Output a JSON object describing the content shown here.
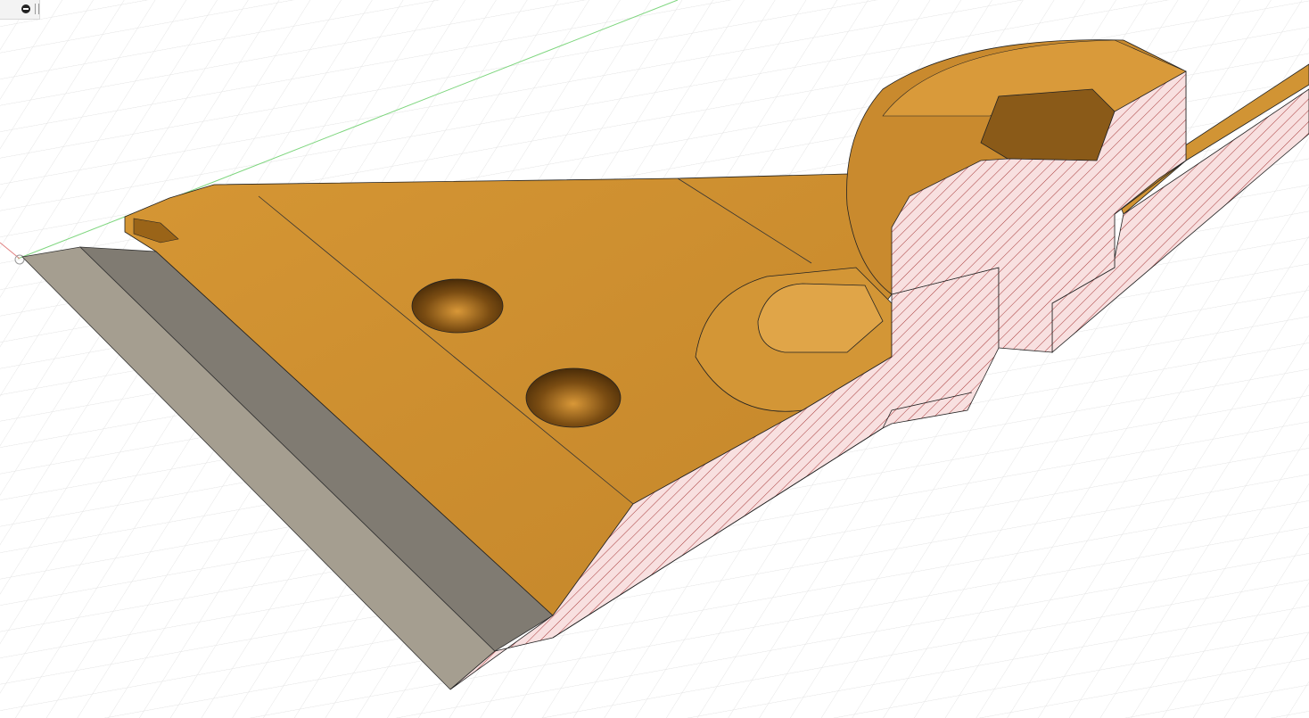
{
  "viewport": {
    "model": "section-view-scraper-body",
    "colors": {
      "body": "#c88a2c",
      "body_light": "#d99a3a",
      "body_dark": "#8a5a18",
      "blade_light": "#a59e90",
      "blade_dark": "#7e7a72",
      "section_fill": "#f8e0e0",
      "section_hatch": "#b03030",
      "grid": "#dcdcdc",
      "axis_green": "#7ed67e"
    }
  },
  "panel": {
    "collapse_icon": "minus-circle-icon",
    "handle_icon": "drag-handle-icon"
  }
}
